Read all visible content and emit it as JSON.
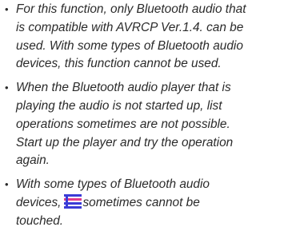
{
  "notes": [
    {
      "lines": [
        "For this function, only Bluetooth audio that",
        "is compatible with AVRCP Ver.1.4. can be",
        "used. With some types of Bluetooth audio",
        "devices, this function cannot be used."
      ]
    },
    {
      "lines": [
        "When the Bluetooth audio player that is",
        "playing the audio is not started up, list",
        "operations sometimes are not possible.",
        "Start up the player and try the operation",
        "again."
      ]
    },
    {
      "lines": [
        "With some types of Bluetooth audio",
        "devices,",
        "sometimes cannot be",
        "touched."
      ],
      "icon": "list-menu-icon"
    }
  ],
  "colors": {
    "text": "#2b2b2b",
    "icon_blue": "#3b3bd6",
    "icon_pink": "#e23a8c"
  }
}
